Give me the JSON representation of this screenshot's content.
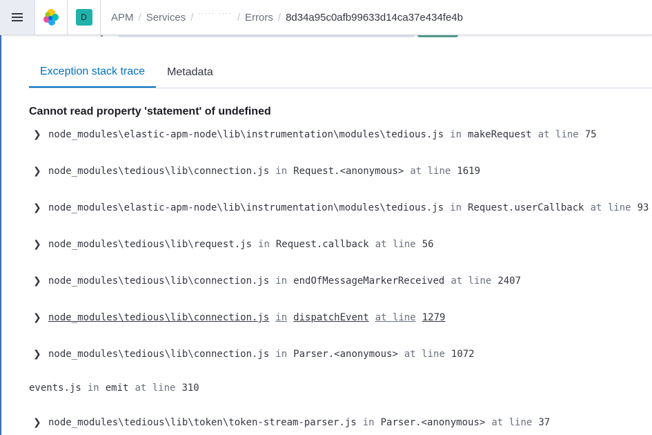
{
  "header": {
    "breadcrumbs": [
      "APM",
      "Services",
      "",
      "Errors",
      "8d34a95c0afb99633d14ca37e434fe4b"
    ],
    "hidden_crumb": "····· ····",
    "space_initial": "D"
  },
  "tabs": [
    "Exception stack trace",
    "Metadata"
  ],
  "error": {
    "message": "Cannot read property 'statement' of undefined",
    "frames": [
      {
        "path": "node_modules\\elastic-apm-node\\lib\\instrumentation\\modules\\tedious.js",
        "in": "in",
        "fn": "makeRequest",
        "at": "at line",
        "line": "75",
        "expandable": true
      },
      {
        "path": "node_modules\\tedious\\lib\\connection.js",
        "in": "in",
        "fn": "Request.<anonymous>",
        "at": "at line",
        "line": "1619",
        "expandable": true
      },
      {
        "path": "node_modules\\elastic-apm-node\\lib\\instrumentation\\modules\\tedious.js",
        "in": "in",
        "fn": "Request.userCallback",
        "at": "at line",
        "line": "93",
        "expandable": true
      },
      {
        "path": "node_modules\\tedious\\lib\\request.js",
        "in": "in",
        "fn": "Request.callback",
        "at": "at line",
        "line": "56",
        "expandable": true
      },
      {
        "path": "node_modules\\tedious\\lib\\connection.js",
        "in": "in",
        "fn": "endOfMessageMarkerReceived",
        "at": "at line",
        "line": "2407",
        "expandable": true
      },
      {
        "path": "node_modules\\tedious\\lib\\connection.js",
        "in": "in",
        "fn": "dispatchEvent",
        "at": "at line",
        "line": "1279",
        "expandable": true,
        "hovered": true
      },
      {
        "path": "node_modules\\tedious\\lib\\connection.js",
        "in": "in",
        "fn": "Parser.<anonymous>",
        "at": "at line",
        "line": "1072",
        "expandable": true
      },
      {
        "path": "events.js",
        "in": "in",
        "fn": "emit",
        "at": "at line",
        "line": "310",
        "expandable": false
      },
      {
        "path": "node_modules\\tedious\\lib\\token\\token-stream-parser.js",
        "in": "in",
        "fn": "Parser.<anonymous>",
        "at": "at line",
        "line": "37",
        "expandable": true
      }
    ]
  },
  "colors": {
    "accent": "#0071c2",
    "space_badge": "#20b2aa",
    "nav_bar": "#3b6fb8"
  },
  "icons": {
    "menu": "hamburger-menu-icon",
    "logo": "elastic-logo-icon",
    "frame_toggle": "chevron-right-icon"
  }
}
